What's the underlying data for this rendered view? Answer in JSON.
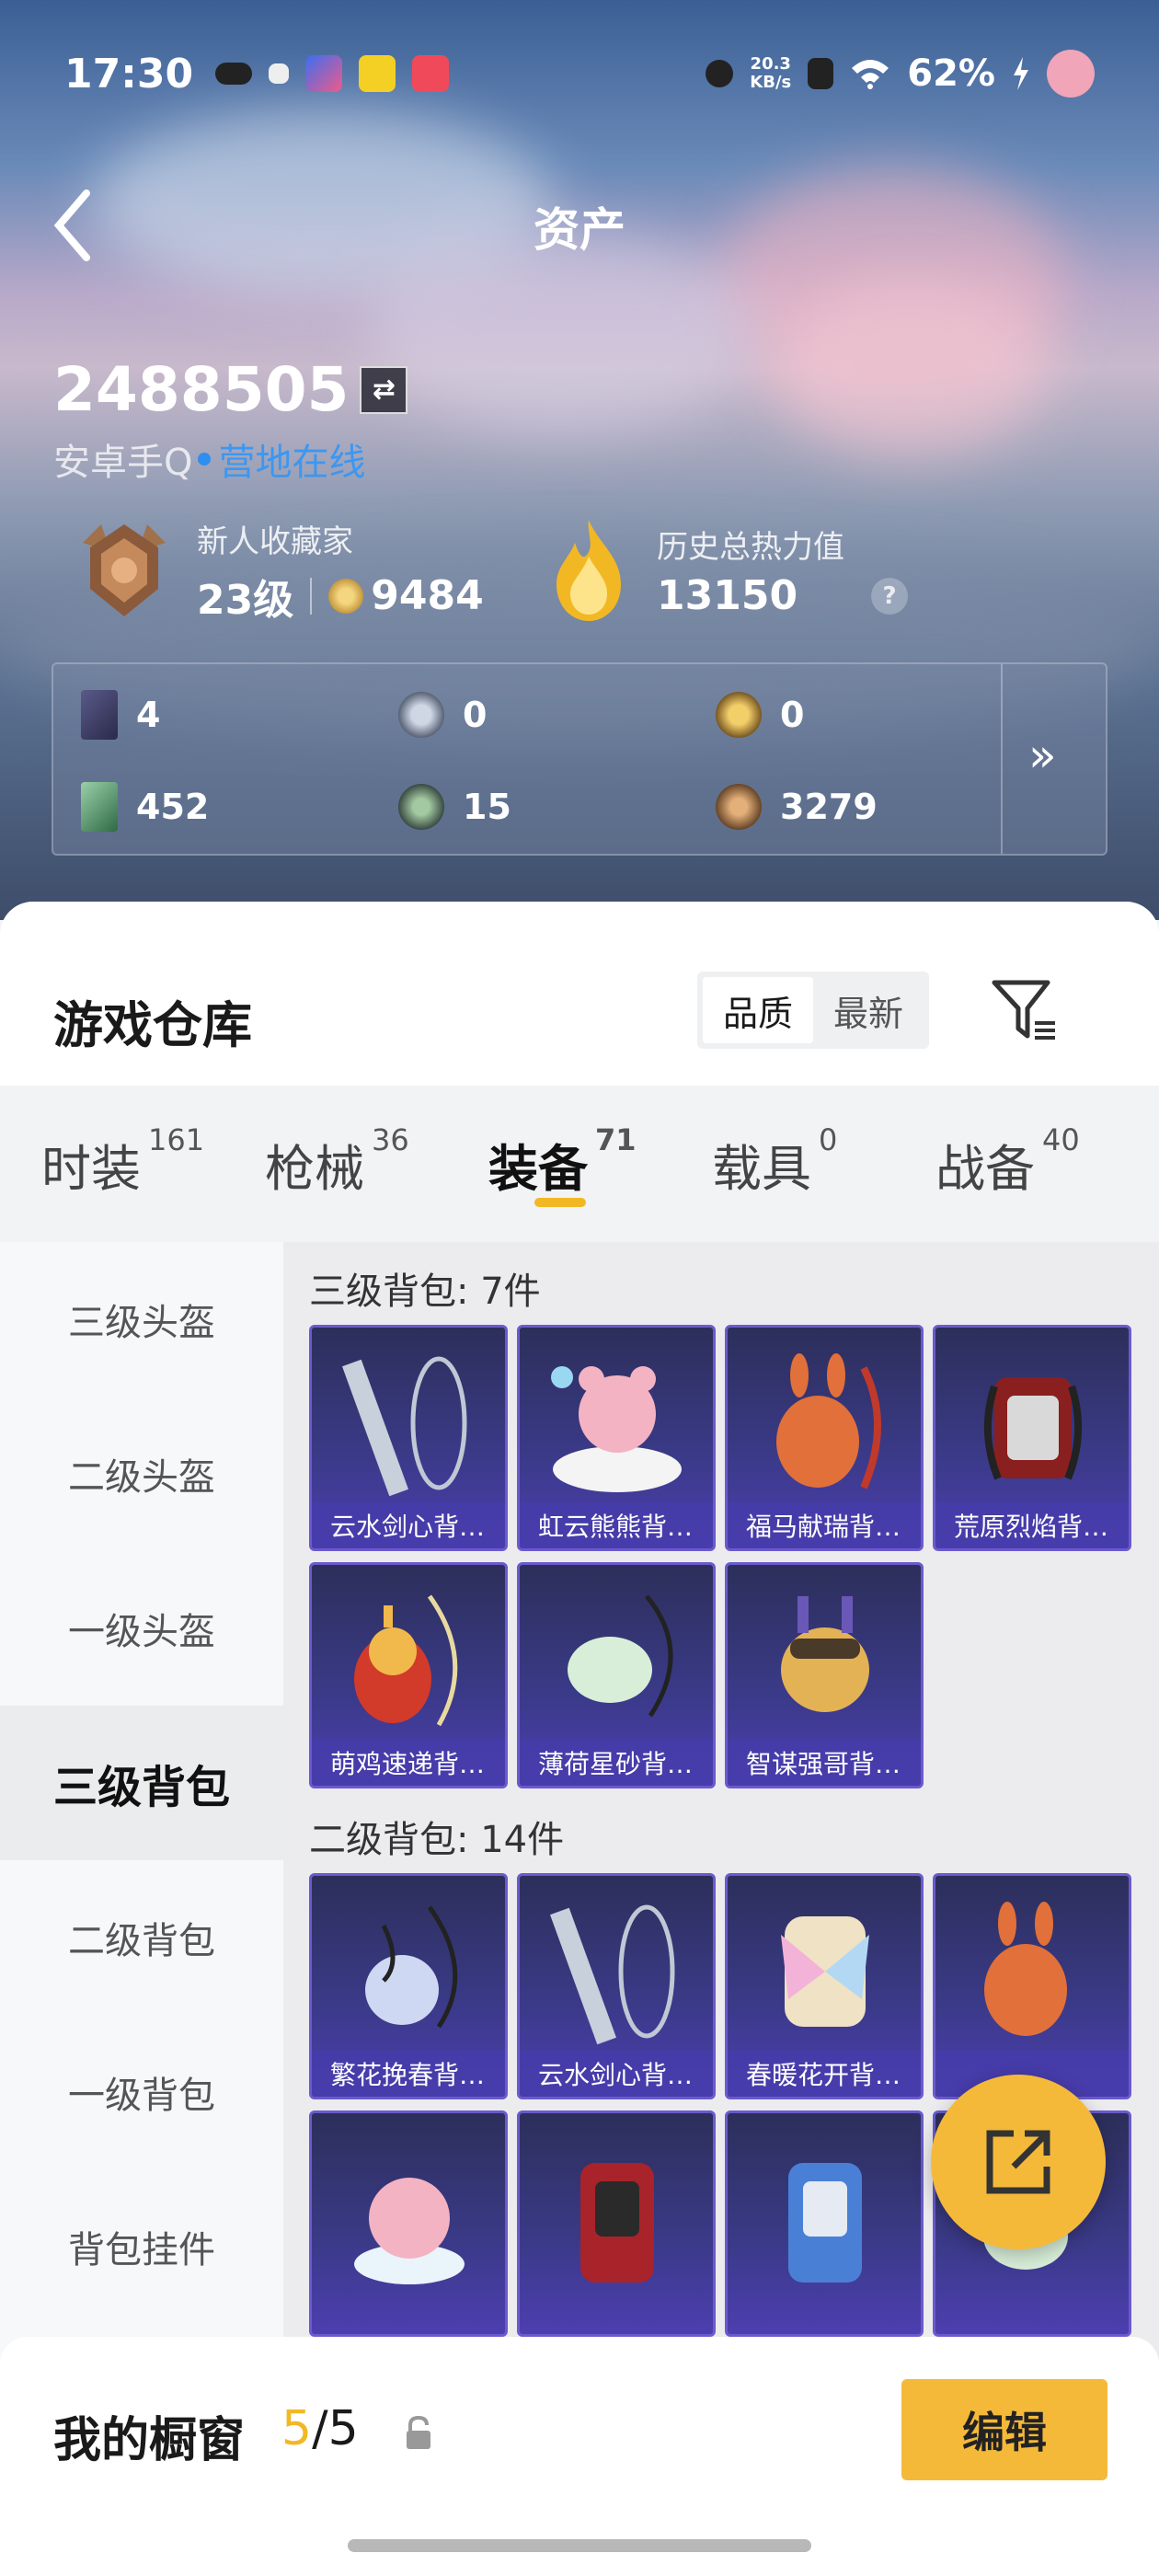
{
  "status_bar": {
    "time": "17:30",
    "net_speed_top": "20.3",
    "net_speed_unit": "KB/s",
    "battery": "62%"
  },
  "header": {
    "title": "资产"
  },
  "user": {
    "id": "2488505",
    "platform": "安卓手Q",
    "online_status": "营地在线"
  },
  "rank": {
    "name": "新人收藏家",
    "level": "23级",
    "coins": "9484"
  },
  "heat": {
    "label": "历史总热力值",
    "value": "13150",
    "help": "?"
  },
  "currencies": [
    {
      "icon": "card-icon",
      "value": "4"
    },
    {
      "icon": "silver-token-icon",
      "value": "0"
    },
    {
      "icon": "gold-token-icon",
      "value": "0"
    },
    {
      "icon": "ticket-icon",
      "value": "452"
    },
    {
      "icon": "green-coin-icon",
      "value": "15"
    },
    {
      "icon": "bronze-coin-icon",
      "value": "3279"
    }
  ],
  "warehouse": {
    "title": "游戏仓库",
    "sort_quality": "品质",
    "sort_newest": "最新"
  },
  "tabs": [
    {
      "label": "时装",
      "count": "161"
    },
    {
      "label": "枪械",
      "count": "36"
    },
    {
      "label": "装备",
      "count": "71"
    },
    {
      "label": "载具",
      "count": "0"
    },
    {
      "label": "战备",
      "count": "40"
    }
  ],
  "side_nav": [
    "三级头盔",
    "二级头盔",
    "一级头盔",
    "三级背包",
    "二级背包",
    "一级背包",
    "背包挂件"
  ],
  "groups": [
    {
      "title": "三级背包: 7件",
      "items": [
        "云水剑心背…",
        "虹云熊熊背…",
        "福马献瑞背…",
        "荒原烈焰背…",
        "萌鸡速递背…",
        "薄荷星砂背…",
        "智谋强哥背…"
      ]
    },
    {
      "title": "二级背包: 14件",
      "items": [
        "繁花挽春背…",
        "云水剑心背…",
        "春暖花开背…",
        "",
        "",
        "",
        "",
        ""
      ]
    }
  ],
  "showcase": {
    "label": "我的橱窗",
    "current": "5",
    "total": "/5"
  },
  "edit_label": "编辑",
  "colors": {
    "accent": "#f5b93a",
    "card_bg": "#3b3a8a",
    "online": "#3c97f2"
  }
}
